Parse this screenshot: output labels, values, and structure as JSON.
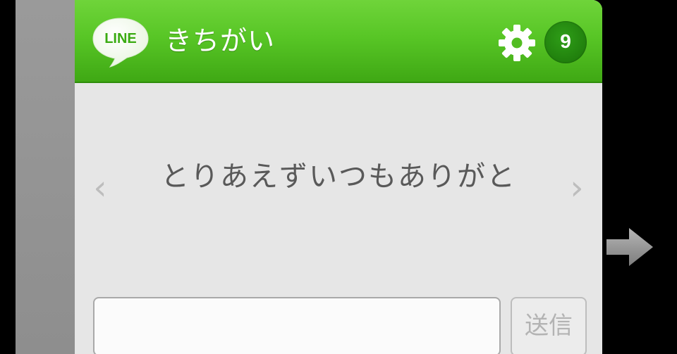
{
  "widget": {
    "app_logo_text": "LINE",
    "title": "きちがい",
    "badge_count": "9",
    "message": "とりあえずいつもありがと",
    "prev_glyph": "‹",
    "next_glyph": "›",
    "input": {
      "value": "",
      "placeholder": ""
    },
    "send_label": "送信"
  },
  "icons": [
    "line-logo-icon",
    "gear-icon",
    "chevron-left-icon",
    "chevron-right-icon",
    "arrow-right-icon"
  ],
  "colors": {
    "header_green": "#58c626",
    "badge_green": "#1a7208",
    "message_text": "#595959",
    "panel_bg": "#e6e6e6"
  }
}
